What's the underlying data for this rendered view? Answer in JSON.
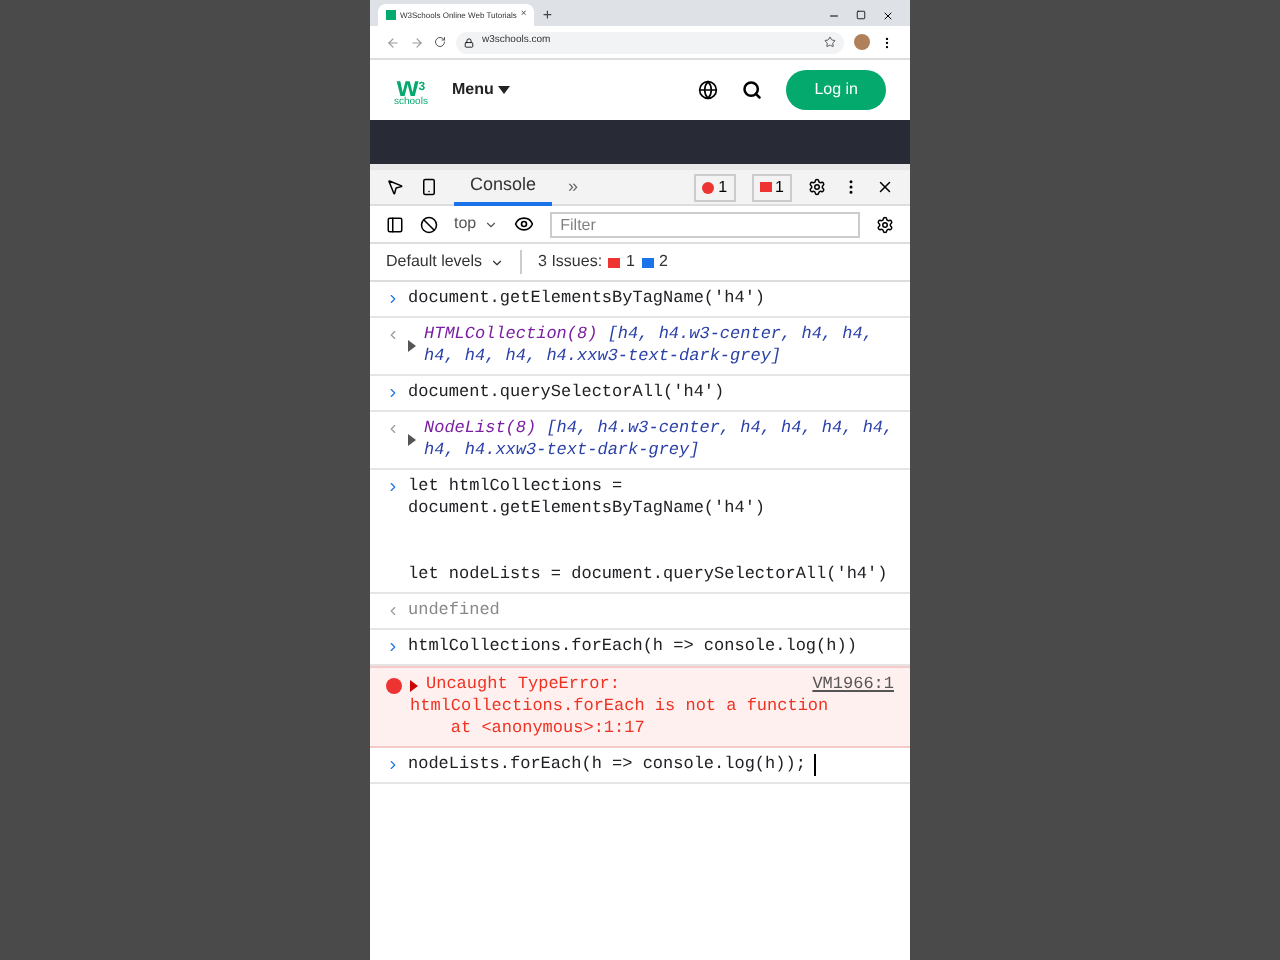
{
  "browser": {
    "tab_title": "W3Schools Online Web Tutorials",
    "tab_close": "×",
    "new_tab": "+",
    "url": "w3schools.com"
  },
  "site": {
    "logo_mark": "w",
    "logo_sup": "3",
    "logo_name": "schools",
    "menu": "Menu",
    "login": "Log in"
  },
  "devtools": {
    "tabs": [
      {
        "label": "Console",
        "selected": true
      }
    ],
    "more": "»",
    "error_count": "1",
    "warning_count": "1",
    "context": "top",
    "filter": {
      "placeholder": "Filter"
    },
    "levels": "Default levels",
    "issues": {
      "label": "3 Issues:",
      "errors": "1",
      "infos": "2"
    }
  },
  "console": [
    {
      "kind": "input",
      "lines": [
        "document.getElementsByTagName('h4')"
      ]
    },
    {
      "kind": "object",
      "name": "HTMLCollection(8)",
      "text": " [h4, h4.w3-center, h4, h4, h4, h4, h4, h4.xxw3-text-dark-grey]"
    },
    {
      "kind": "input",
      "lines": [
        "document.querySelectorAll('h4')"
      ]
    },
    {
      "kind": "object",
      "name": "NodeList(8)",
      "text": " [h4, h4.w3-center, h4, h4, h4, h4, h4, h4.xxw3-text-dark-grey]"
    },
    {
      "kind": "input",
      "lines": [
        "let htmlCollections =",
        "document.getElementsByTagName('h4')"
      ],
      "after_gap": [
        "let nodeLists = document.querySelectorAll('h4')"
      ]
    },
    {
      "kind": "result",
      "lines": [
        "undefined"
      ]
    },
    {
      "kind": "input",
      "lines": [
        "htmlCollections.forEach(h => console.log(h))"
      ]
    },
    {
      "kind": "error",
      "lines": [
        "Uncaught TypeError:",
        "htmlCollections.forEach is not a function",
        "    at <anonymous>:1:17"
      ],
      "source": "VM1966:1"
    },
    {
      "kind": "prompt",
      "lines": [
        "nodeLists.forEach(h => console.log(h));"
      ]
    }
  ]
}
